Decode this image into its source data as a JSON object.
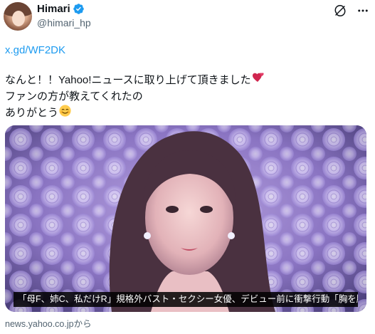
{
  "author": {
    "display_name": "Himari",
    "handle": "@himari_hp",
    "verified_badge_color": "#1d9bf0"
  },
  "header_actions": {
    "grok_icon": "grok-icon",
    "more_icon": "more-icon"
  },
  "tweet": {
    "link": "x.gd/WF2DK",
    "lines": [
      "なんと！！Yahoo!ニュースに取り上げて頂きました",
      "ファンの方が教えてくれたの",
      "ありがとう"
    ],
    "emoji": [
      "two-hearts",
      "smiling-face"
    ]
  },
  "card": {
    "caption": "「母F、姉C、私だけR」規格外バスト・セクシー女優、デビュー前に衝撃行動「胸を脂…",
    "source": "news.yahoo.co.jpから"
  },
  "colors": {
    "link": "#1d9bf0",
    "secondary_text": "#536471",
    "background": "#ffffff"
  }
}
